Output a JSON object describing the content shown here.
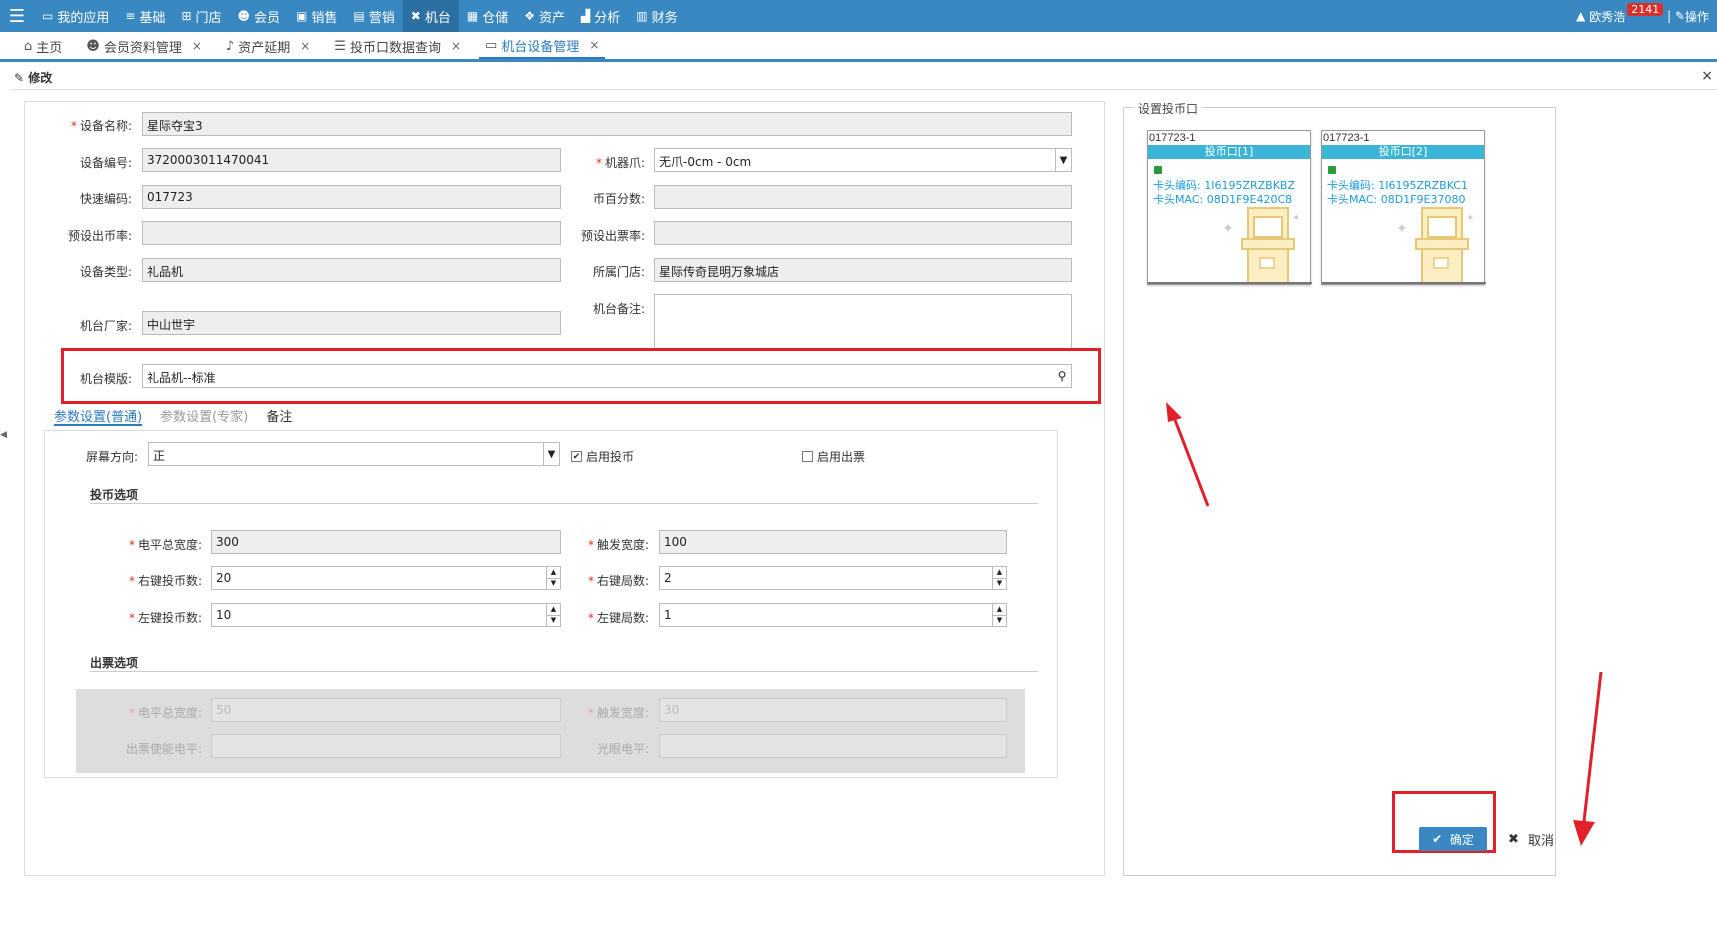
{
  "topbar": {
    "menu": [
      {
        "label": "我的应用",
        "icon": "desktop-icon"
      },
      {
        "label": "基础",
        "icon": "database-icon"
      },
      {
        "label": "门店",
        "icon": "sitemap-icon"
      },
      {
        "label": "会员",
        "icon": "user-icon"
      },
      {
        "label": "销售",
        "icon": "briefcase-icon"
      },
      {
        "label": "营销",
        "icon": "gift-icon"
      },
      {
        "label": "机台",
        "icon": "crosshair-icon"
      },
      {
        "label": "仓储",
        "icon": "box-icon"
      },
      {
        "label": "资产",
        "icon": "cubes-icon"
      },
      {
        "label": "分析",
        "icon": "chart-icon"
      },
      {
        "label": "财务",
        "icon": "ledger-icon"
      }
    ],
    "user": "欧秀浩",
    "badge": "2141",
    "ops": "操作"
  },
  "tabs": [
    {
      "label": "主页",
      "icon": "home-icon",
      "closable": false
    },
    {
      "label": "会员资料管理",
      "icon": "users-icon",
      "closable": true
    },
    {
      "label": "资产延期",
      "icon": "bell-icon",
      "closable": true
    },
    {
      "label": "投币口数据查询",
      "icon": "list-icon",
      "closable": true
    },
    {
      "label": "机台设备管理",
      "icon": "monitor-icon",
      "closable": true
    }
  ],
  "dialog": {
    "title": "修改",
    "close": "×"
  },
  "form": {
    "device_name": {
      "label": "设备名称:",
      "value": "星际夺宝3"
    },
    "device_no": {
      "label": "设备编号:",
      "value": "3720003011470041"
    },
    "claw": {
      "label": "机器爪:",
      "value": "无爪-0cm - 0cm"
    },
    "quick_code": {
      "label": "快速编码:",
      "value": "017723"
    },
    "coin_percent": {
      "label": "币百分数:",
      "value": ""
    },
    "preset_coin_rate": {
      "label": "预设出币率:",
      "value": ""
    },
    "preset_ticket_rate": {
      "label": "预设出票率:",
      "value": ""
    },
    "device_type": {
      "label": "设备类型:",
      "value": "礼品机"
    },
    "store": {
      "label": "所属门店:",
      "value": "星际传奇昆明万象城店"
    },
    "remark": {
      "label": "机台备注:",
      "value": ""
    },
    "manufacturer": {
      "label": "机台厂家:",
      "value": "中山世宇"
    },
    "template": {
      "label": "机台模版:",
      "value": "礼品机--标准"
    }
  },
  "subtabs": [
    "参数设置(普通)",
    "参数设置(专家)",
    "备注"
  ],
  "params": {
    "screen": {
      "label": "屏幕方向:",
      "value": "正"
    },
    "enable_coin": {
      "label": "启用投币",
      "checked": true
    },
    "enable_ticket": {
      "label": "启用出票",
      "checked": false
    },
    "coin_section": "投币选项",
    "level_width": {
      "label": "电平总宽度:",
      "value": "300"
    },
    "trigger_width": {
      "label": "触发宽度:",
      "value": "100"
    },
    "right_coins": {
      "label": "右键投币数:",
      "value": "20"
    },
    "right_rounds": {
      "label": "右键局数:",
      "value": "2"
    },
    "left_coins": {
      "label": "左键投币数:",
      "value": "10"
    },
    "left_rounds": {
      "label": "左键局数:",
      "value": "1"
    },
    "ticket_section": "出票选项",
    "t_level_width": {
      "label": "电平总宽度:",
      "value": "50"
    },
    "t_trigger_width": {
      "label": "触发宽度:",
      "value": "30"
    },
    "t_enable_level": {
      "label": "出票使能电平:",
      "value": ""
    },
    "t_eye_level": {
      "label": "光眼电平:",
      "value": ""
    }
  },
  "coin_slots": {
    "title": "设置投币口",
    "cards": [
      {
        "id": "017723-1",
        "name": "投币口[1]",
        "code": "卡头编码: 1I6195ZRZBKBZ",
        "mac": "卡头MAC: 08D1F9E420C8"
      },
      {
        "id": "017723-1",
        "name": "投币口[2]",
        "code": "卡头编码: 1I6195ZRZBKC1",
        "mac": "卡头MAC: 08D1F9E37080"
      }
    ]
  },
  "buttons": {
    "ok": "确定",
    "cancel": "取消"
  },
  "colors": {
    "primary": "#3a88c2",
    "highlight": "#e0202a",
    "link": "#1e9bd7"
  }
}
